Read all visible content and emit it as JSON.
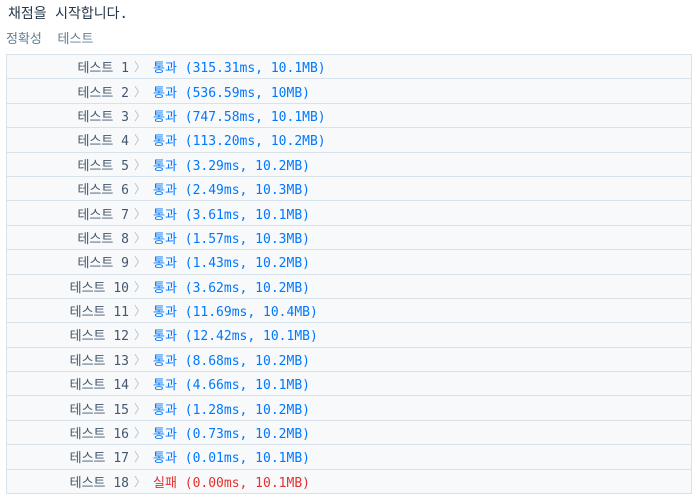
{
  "header": {
    "title": "채점을 시작합니다.",
    "section_label": "정확성  테스트"
  },
  "colors": {
    "pass": "#0078ff",
    "fail": "#e4302f",
    "row_border": "#d7e2eb",
    "row_background": "#f7f9fb"
  },
  "arrow_icon": "chevron-right-icon",
  "tests": [
    {
      "name": "테스트 1",
      "result": "통과 (315.31ms, 10.1MB)",
      "status": "pass"
    },
    {
      "name": "테스트 2",
      "result": "통과 (536.59ms, 10MB)",
      "status": "pass"
    },
    {
      "name": "테스트 3",
      "result": "통과 (747.58ms, 10.1MB)",
      "status": "pass"
    },
    {
      "name": "테스트 4",
      "result": "통과 (113.20ms, 10.2MB)",
      "status": "pass"
    },
    {
      "name": "테스트 5",
      "result": "통과 (3.29ms, 10.2MB)",
      "status": "pass"
    },
    {
      "name": "테스트 6",
      "result": "통과 (2.49ms, 10.3MB)",
      "status": "pass"
    },
    {
      "name": "테스트 7",
      "result": "통과 (3.61ms, 10.1MB)",
      "status": "pass"
    },
    {
      "name": "테스트 8",
      "result": "통과 (1.57ms, 10.3MB)",
      "status": "pass"
    },
    {
      "name": "테스트 9",
      "result": "통과 (1.43ms, 10.2MB)",
      "status": "pass"
    },
    {
      "name": "테스트 10",
      "result": "통과 (3.62ms, 10.2MB)",
      "status": "pass"
    },
    {
      "name": "테스트 11",
      "result": "통과 (11.69ms, 10.4MB)",
      "status": "pass"
    },
    {
      "name": "테스트 12",
      "result": "통과 (12.42ms, 10.1MB)",
      "status": "pass"
    },
    {
      "name": "테스트 13",
      "result": "통과 (8.68ms, 10.2MB)",
      "status": "pass"
    },
    {
      "name": "테스트 14",
      "result": "통과 (4.66ms, 10.1MB)",
      "status": "pass"
    },
    {
      "name": "테스트 15",
      "result": "통과 (1.28ms, 10.2MB)",
      "status": "pass"
    },
    {
      "name": "테스트 16",
      "result": "통과 (0.73ms, 10.2MB)",
      "status": "pass"
    },
    {
      "name": "테스트 17",
      "result": "통과 (0.01ms, 10.1MB)",
      "status": "pass"
    },
    {
      "name": "테스트 18",
      "result": "실패 (0.00ms, 10.1MB)",
      "status": "fail"
    }
  ]
}
